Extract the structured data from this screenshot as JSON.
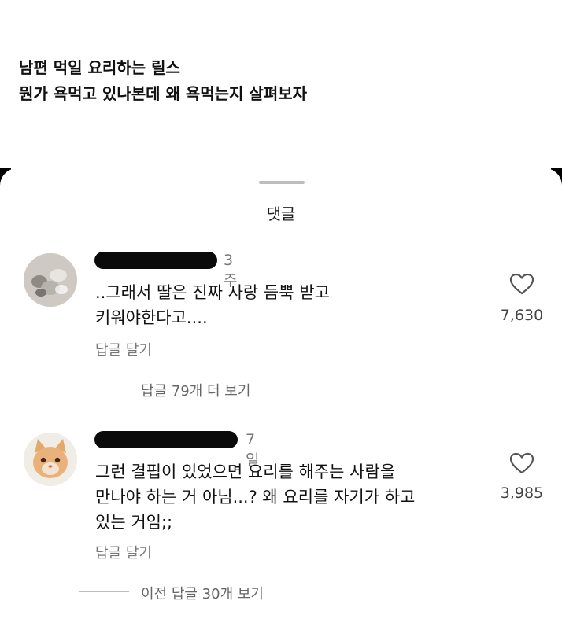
{
  "caption": {
    "line1": "남편 먹일 요리하는 릴스",
    "line2": "뭔가 욕먹고 있나본데 왜 욕먹는지 살펴보자"
  },
  "sheet": {
    "title": "댓글"
  },
  "comments": [
    {
      "time": "3주",
      "lines": [
        "..그래서 딸은 진짜 사랑 듬뿍 받고",
        "키워야한다고...."
      ],
      "reply_label": "답글 달기",
      "likes": "7,630",
      "more_replies": "답글 79개 더 보기"
    },
    {
      "time": "7일",
      "lines": [
        "그런 결핍이 있었으면 요리를 해주는 사람을",
        "만나야 하는 거 아님...? 왜 요리를 자기가 하고",
        "있는 거임;;"
      ],
      "reply_label": "답글 달기",
      "likes": "3,985",
      "more_replies": "이전 답글 30개 보기"
    }
  ],
  "colors": {
    "background": "#ffffff",
    "text": "#111111",
    "muted": "#777777",
    "redaction": "#0a0a0a"
  },
  "icons": {
    "like": "heart-outline-icon"
  }
}
